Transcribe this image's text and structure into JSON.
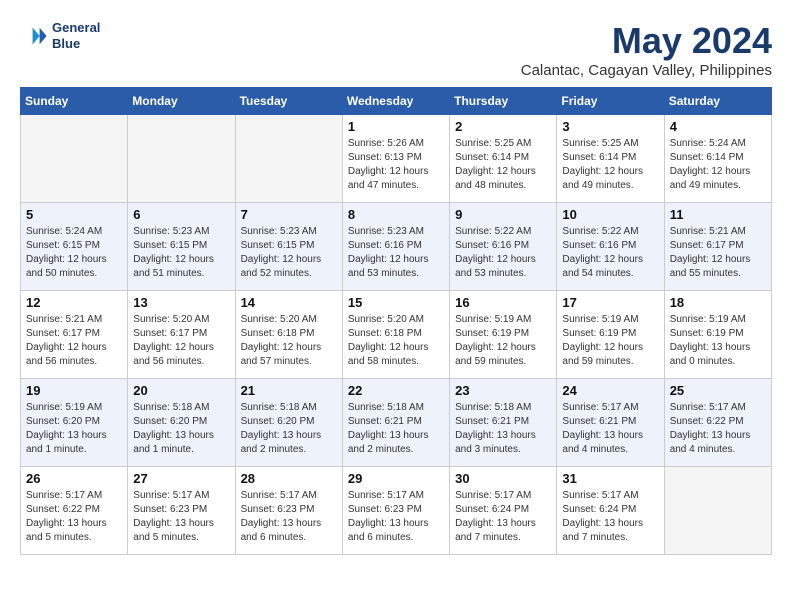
{
  "header": {
    "logo_line1": "General",
    "logo_line2": "Blue",
    "month_title": "May 2024",
    "location": "Calantac, Cagayan Valley, Philippines"
  },
  "days_of_week": [
    "Sunday",
    "Monday",
    "Tuesday",
    "Wednesday",
    "Thursday",
    "Friday",
    "Saturday"
  ],
  "weeks": [
    [
      {
        "num": "",
        "info": ""
      },
      {
        "num": "",
        "info": ""
      },
      {
        "num": "",
        "info": ""
      },
      {
        "num": "1",
        "info": "Sunrise: 5:26 AM\nSunset: 6:13 PM\nDaylight: 12 hours\nand 47 minutes."
      },
      {
        "num": "2",
        "info": "Sunrise: 5:25 AM\nSunset: 6:14 PM\nDaylight: 12 hours\nand 48 minutes."
      },
      {
        "num": "3",
        "info": "Sunrise: 5:25 AM\nSunset: 6:14 PM\nDaylight: 12 hours\nand 49 minutes."
      },
      {
        "num": "4",
        "info": "Sunrise: 5:24 AM\nSunset: 6:14 PM\nDaylight: 12 hours\nand 49 minutes."
      }
    ],
    [
      {
        "num": "5",
        "info": "Sunrise: 5:24 AM\nSunset: 6:15 PM\nDaylight: 12 hours\nand 50 minutes."
      },
      {
        "num": "6",
        "info": "Sunrise: 5:23 AM\nSunset: 6:15 PM\nDaylight: 12 hours\nand 51 minutes."
      },
      {
        "num": "7",
        "info": "Sunrise: 5:23 AM\nSunset: 6:15 PM\nDaylight: 12 hours\nand 52 minutes."
      },
      {
        "num": "8",
        "info": "Sunrise: 5:23 AM\nSunset: 6:16 PM\nDaylight: 12 hours\nand 53 minutes."
      },
      {
        "num": "9",
        "info": "Sunrise: 5:22 AM\nSunset: 6:16 PM\nDaylight: 12 hours\nand 53 minutes."
      },
      {
        "num": "10",
        "info": "Sunrise: 5:22 AM\nSunset: 6:16 PM\nDaylight: 12 hours\nand 54 minutes."
      },
      {
        "num": "11",
        "info": "Sunrise: 5:21 AM\nSunset: 6:17 PM\nDaylight: 12 hours\nand 55 minutes."
      }
    ],
    [
      {
        "num": "12",
        "info": "Sunrise: 5:21 AM\nSunset: 6:17 PM\nDaylight: 12 hours\nand 56 minutes."
      },
      {
        "num": "13",
        "info": "Sunrise: 5:20 AM\nSunset: 6:17 PM\nDaylight: 12 hours\nand 56 minutes."
      },
      {
        "num": "14",
        "info": "Sunrise: 5:20 AM\nSunset: 6:18 PM\nDaylight: 12 hours\nand 57 minutes."
      },
      {
        "num": "15",
        "info": "Sunrise: 5:20 AM\nSunset: 6:18 PM\nDaylight: 12 hours\nand 58 minutes."
      },
      {
        "num": "16",
        "info": "Sunrise: 5:19 AM\nSunset: 6:19 PM\nDaylight: 12 hours\nand 59 minutes."
      },
      {
        "num": "17",
        "info": "Sunrise: 5:19 AM\nSunset: 6:19 PM\nDaylight: 12 hours\nand 59 minutes."
      },
      {
        "num": "18",
        "info": "Sunrise: 5:19 AM\nSunset: 6:19 PM\nDaylight: 13 hours\nand 0 minutes."
      }
    ],
    [
      {
        "num": "19",
        "info": "Sunrise: 5:19 AM\nSunset: 6:20 PM\nDaylight: 13 hours\nand 1 minute."
      },
      {
        "num": "20",
        "info": "Sunrise: 5:18 AM\nSunset: 6:20 PM\nDaylight: 13 hours\nand 1 minute."
      },
      {
        "num": "21",
        "info": "Sunrise: 5:18 AM\nSunset: 6:20 PM\nDaylight: 13 hours\nand 2 minutes."
      },
      {
        "num": "22",
        "info": "Sunrise: 5:18 AM\nSunset: 6:21 PM\nDaylight: 13 hours\nand 2 minutes."
      },
      {
        "num": "23",
        "info": "Sunrise: 5:18 AM\nSunset: 6:21 PM\nDaylight: 13 hours\nand 3 minutes."
      },
      {
        "num": "24",
        "info": "Sunrise: 5:17 AM\nSunset: 6:21 PM\nDaylight: 13 hours\nand 4 minutes."
      },
      {
        "num": "25",
        "info": "Sunrise: 5:17 AM\nSunset: 6:22 PM\nDaylight: 13 hours\nand 4 minutes."
      }
    ],
    [
      {
        "num": "26",
        "info": "Sunrise: 5:17 AM\nSunset: 6:22 PM\nDaylight: 13 hours\nand 5 minutes."
      },
      {
        "num": "27",
        "info": "Sunrise: 5:17 AM\nSunset: 6:23 PM\nDaylight: 13 hours\nand 5 minutes."
      },
      {
        "num": "28",
        "info": "Sunrise: 5:17 AM\nSunset: 6:23 PM\nDaylight: 13 hours\nand 6 minutes."
      },
      {
        "num": "29",
        "info": "Sunrise: 5:17 AM\nSunset: 6:23 PM\nDaylight: 13 hours\nand 6 minutes."
      },
      {
        "num": "30",
        "info": "Sunrise: 5:17 AM\nSunset: 6:24 PM\nDaylight: 13 hours\nand 7 minutes."
      },
      {
        "num": "31",
        "info": "Sunrise: 5:17 AM\nSunset: 6:24 PM\nDaylight: 13 hours\nand 7 minutes."
      },
      {
        "num": "",
        "info": ""
      }
    ]
  ]
}
